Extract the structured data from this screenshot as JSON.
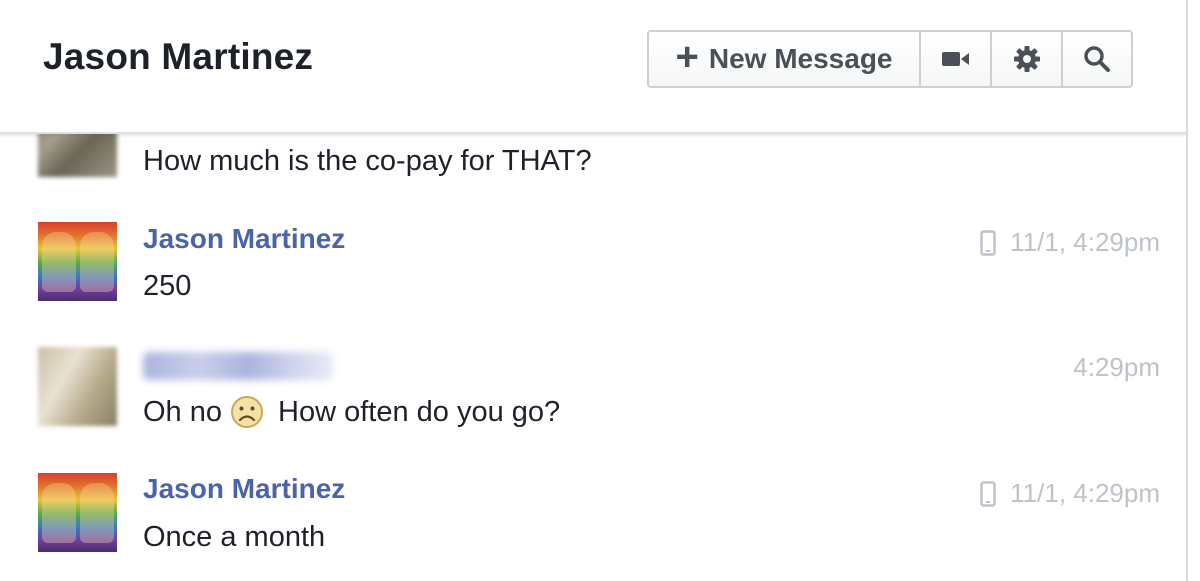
{
  "header": {
    "title": "Jason Martinez",
    "new_message_label": "New Message",
    "icons": [
      "plus-icon",
      "video-camera-icon",
      "gear-icon",
      "search-icon"
    ]
  },
  "messages": [
    {
      "sender": "",
      "text": "How much is the co-pay for THAT?",
      "time": "",
      "avatar": "blurred-avatar"
    },
    {
      "sender": "Jason Martinez",
      "text": "250",
      "time": "11/1, 4:29pm",
      "avatar": "rainbow-avatar",
      "sent_from_mobile": true
    },
    {
      "sender": "",
      "sender_redacted": true,
      "text_before": "Oh no",
      "emoji": "frown-emoji",
      "text_after": "How often do you go?",
      "time": "4:29pm",
      "avatar": "blurred-avatar"
    },
    {
      "sender": "Jason Martinez",
      "text": "Once a month",
      "time": "11/1, 4:29pm",
      "avatar": "rainbow-avatar",
      "sent_from_mobile": true
    }
  ],
  "colors": {
    "sender_name": "#4b64a8",
    "message_text": "#1d2129",
    "timestamp": "#bec3c9",
    "toolbar_border": "#ccd0d5"
  }
}
